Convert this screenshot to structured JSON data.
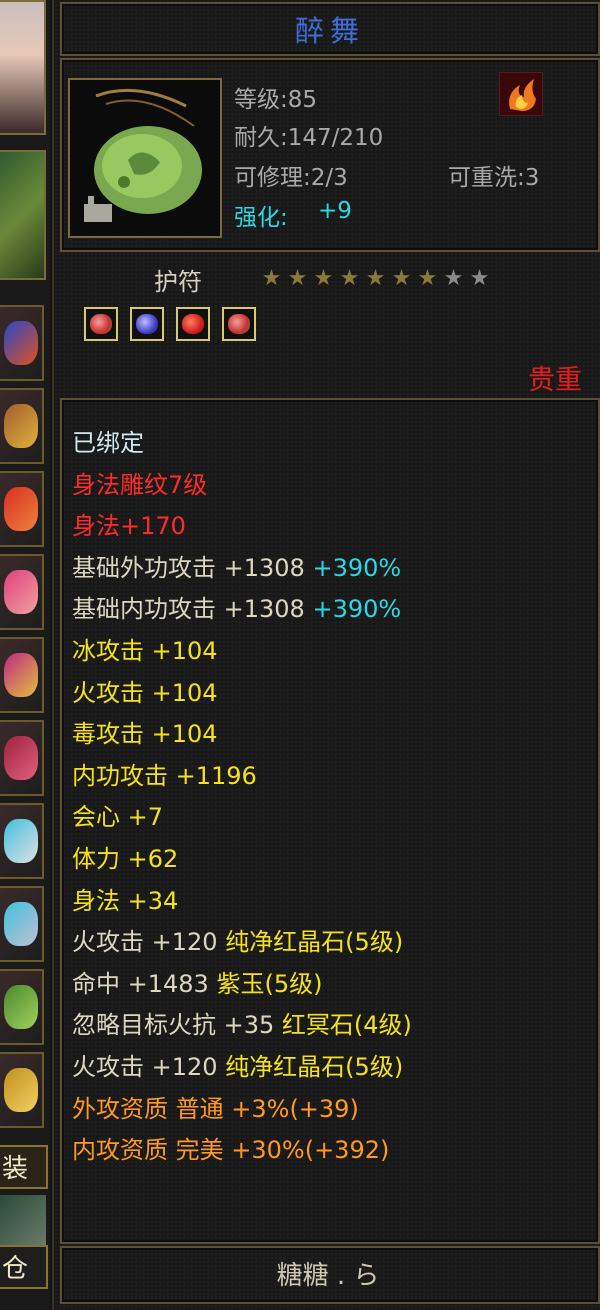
{
  "left_strip": {
    "tab_equipment": "装备",
    "tab_warehouse": "仓库"
  },
  "item": {
    "name": "醉舞",
    "level": "等级:85",
    "durability": "耐久:147/210",
    "repairable": "可修理:2/3",
    "rewash": "可重洗:3",
    "enhance_label": "强化:",
    "enhance_value": "+9",
    "type": "护符",
    "stars_filled": 7,
    "stars_total": 9,
    "rarity": "贵重",
    "gem_slots": [
      {
        "color": "#e04a4a",
        "name": "gem-red-green"
      },
      {
        "color": "#4a4ad8",
        "name": "gem-purple"
      },
      {
        "color": "#d82020",
        "name": "gem-red"
      },
      {
        "color": "#e04a4a",
        "name": "gem-red-green"
      }
    ]
  },
  "attributes": [
    {
      "segments": [
        {
          "text": "已绑定",
          "color": "white"
        }
      ]
    },
    {
      "segments": [
        {
          "text": "身法雕纹7级",
          "color": "red"
        }
      ]
    },
    {
      "segments": [
        {
          "text": "身法+170",
          "color": "red"
        }
      ]
    },
    {
      "segments": [
        {
          "text": "基础外功攻击 +1308 ",
          "color": "light"
        },
        {
          "text": "+390%",
          "color": "cyan"
        }
      ]
    },
    {
      "segments": [
        {
          "text": "基础内功攻击 +1308 ",
          "color": "light"
        },
        {
          "text": "+390%",
          "color": "cyan"
        }
      ]
    },
    {
      "segments": [
        {
          "text": "冰攻击 +104",
          "color": "yellow"
        }
      ]
    },
    {
      "segments": [
        {
          "text": "火攻击 +104",
          "color": "yellow"
        }
      ]
    },
    {
      "segments": [
        {
          "text": "毒攻击 +104",
          "color": "yellow"
        }
      ]
    },
    {
      "segments": [
        {
          "text": "内功攻击 +1196",
          "color": "yellow"
        }
      ]
    },
    {
      "segments": [
        {
          "text": "会心 +7",
          "color": "yellow"
        }
      ]
    },
    {
      "segments": [
        {
          "text": "体力 +62",
          "color": "yellow"
        }
      ]
    },
    {
      "segments": [
        {
          "text": "身法 +34",
          "color": "yellow"
        }
      ]
    },
    {
      "segments": [
        {
          "text": "火攻击 +120 ",
          "color": "light"
        },
        {
          "text": "纯净红晶石(5级)",
          "color": "yellow"
        }
      ]
    },
    {
      "segments": [
        {
          "text": "命中 +1483 ",
          "color": "light"
        },
        {
          "text": "紫玉(5级)",
          "color": "yellow"
        }
      ]
    },
    {
      "segments": [
        {
          "text": "忽略目标火抗 +35 ",
          "color": "light"
        },
        {
          "text": "红冥石(4级)",
          "color": "yellow"
        }
      ]
    },
    {
      "segments": [
        {
          "text": "火攻击 +120 ",
          "color": "light"
        },
        {
          "text": "纯净红晶石(5级)",
          "color": "yellow"
        }
      ]
    },
    {
      "segments": [
        {
          "text": "外攻资质 普通 +3%(+39)",
          "color": "orange"
        }
      ]
    },
    {
      "segments": [
        {
          "text": "内攻资质 完美 +30%(+392)",
          "color": "orange"
        }
      ]
    }
  ],
  "owner": "糖糖 . ら"
}
